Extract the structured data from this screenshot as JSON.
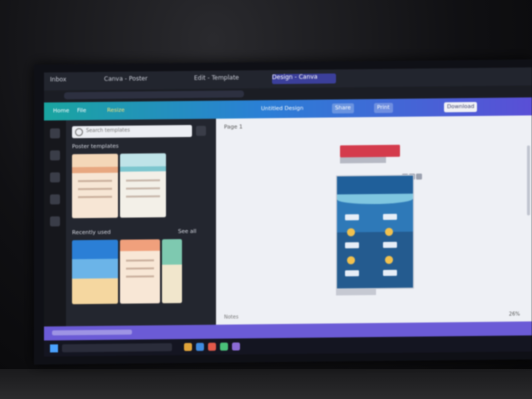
{
  "browser": {
    "tabs": [
      {
        "label": "Inbox",
        "active": false
      },
      {
        "label": "Canva - Poster",
        "active": false
      },
      {
        "label": "Edit - Template",
        "active": false
      },
      {
        "label": "Design - Canva",
        "active": true
      }
    ],
    "url": ""
  },
  "editor": {
    "home_label": "Home",
    "file_label": "File",
    "resize_label": "Resize",
    "actions": [
      {
        "label": "Untitled Design"
      },
      {
        "label": "Share"
      },
      {
        "label": "Print"
      },
      {
        "label": "Download"
      }
    ]
  },
  "left_panel": {
    "search_placeholder": "Search templates",
    "section_1": "Poster templates",
    "section_2": "Recently used",
    "section_2_action": "See all"
  },
  "canvas": {
    "page_label": "Page 1",
    "notes_label": "Notes",
    "zoom_label": "26%"
  },
  "taskbar": {
    "clock": ""
  },
  "colors": {
    "editor_gradient_start": "#1aa5a0",
    "editor_gradient_end": "#5a4fd6",
    "accent_red": "#d43b4c",
    "purple_bar": "#6b5bd6"
  }
}
